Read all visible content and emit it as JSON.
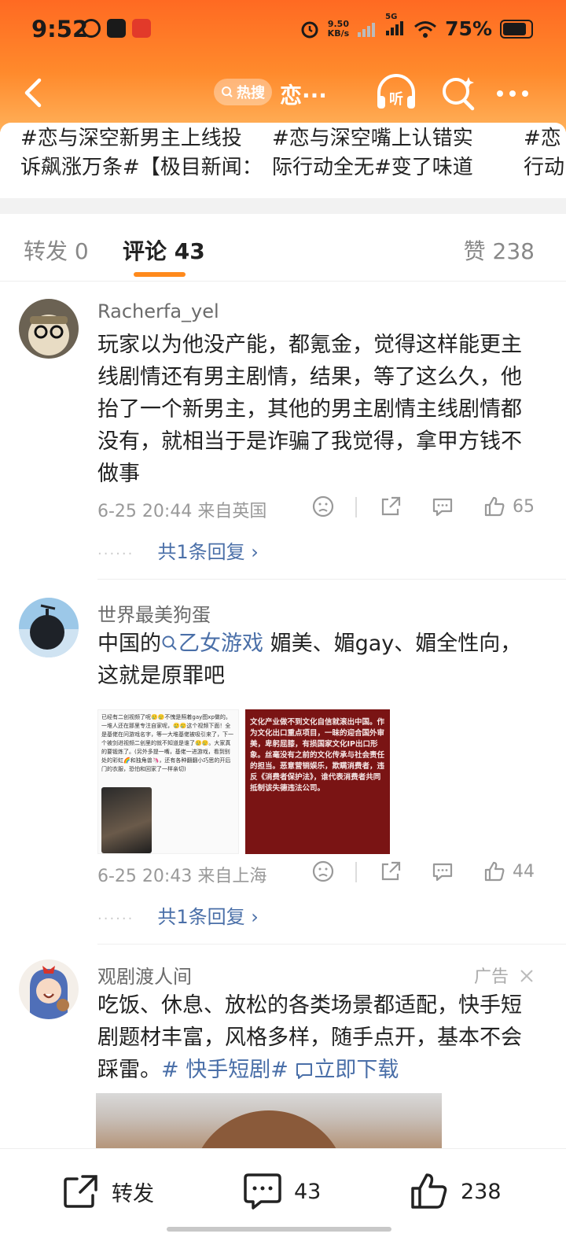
{
  "status_bar": {
    "time": "9:52",
    "left_icons": [
      "weibo-icon",
      "app-icon",
      "app-icon-red"
    ],
    "net_speed_value": "9.50",
    "net_speed_unit": "KB/s",
    "network": "5G",
    "battery": "75%",
    "battery_level": 0.75
  },
  "nav": {
    "hot_label": "热搜",
    "title": "恋···"
  },
  "hashtags": [
    {
      "line1": "#恋与深空新男主上线投",
      "line2": "诉飙涨万条#【极目新闻："
    },
    {
      "line1": "#恋与深空嘴上认错实",
      "line2": "际行动全无#变了味道"
    },
    {
      "line1": "#恋",
      "line2": "行动"
    }
  ],
  "tabs": {
    "repost": "转发 0",
    "comments": "评论 43",
    "likes": "赞 238"
  },
  "comments": [
    {
      "user": "Racherfa_yel",
      "text": "玩家以为他没产能，都氪金，觉得这样能更主线剧情还有男主剧情，结果，等了这么久，他抬了一个新男主，其他的男主剧情主线剧情都没有，就相当于是诈骗了我觉得，拿甲方钱不做事",
      "meta": "6-25 20:44  来自英国",
      "likes": "65",
      "reply": "共1条回复 ›"
    },
    {
      "user": "世界最美狗蛋",
      "text_before": "中国的",
      "link": "乙女游戏",
      "text_after": " 媚美、媚gay、媚全性向，这就是原罪吧",
      "meta": "6-25 20:43  来自上海",
      "likes": "44",
      "reply": "共1条回复 ›",
      "image1_text": "已经有二创视频了呢🥲🥲不愧是照着gay图xp做的。一堆人还在那里专注自家呢，🥲🥲这个视频下面！全是基佬在问游戏名字，等一大堆基佬被吸引来了，下一个被剑进视频二创里的就不知道是谁了🥲🥲。大家真的要锻炼了。(另外多提一嘴，基佬一进游戏，看到别处的彩虹🌈和独角兽🦄，还有各种翻翻小巧思的开后门的衣服，恐怕和回家了一样亲切)",
      "image2_text": "文化产业做不到文化自信就滚出中国。作为文化出口重点项目，一昧的迎合国外审美，卑躬屈膝，有损国家文化IP出口形象。丝毫没有之前的文化传承与社会责任的担当。恶意营销娱乐，欺瞒消费者，违反《消费者保护法》，谁代表消费者共同抵制该失德违法公司。"
    },
    {
      "user": "观剧渡人间",
      "ad_label": "广告",
      "text": "吃饭、休息、放松的各类场景都适配，快手短剧题材丰富，风格多样，随手点开，基本不会踩雷。",
      "tag": "# 快手短剧#",
      "download": "立即下载"
    }
  ],
  "bottom_bar": {
    "repost": "转发",
    "comments": "43",
    "likes": "238"
  }
}
